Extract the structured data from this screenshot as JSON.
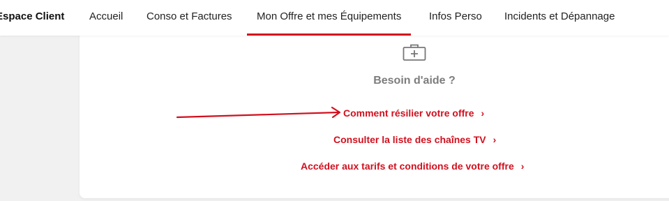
{
  "nav": {
    "brand": "Espace Client",
    "items": [
      {
        "label": "Accueil"
      },
      {
        "label": "Conso et Factures"
      },
      {
        "label": "Mon Offre et mes Équipements"
      },
      {
        "label": "Infos Perso"
      },
      {
        "label": "Incidents et Dépannage"
      }
    ],
    "active_index": 2
  },
  "help": {
    "icon": "medical-kit-icon",
    "title": "Besoin d'aide ?",
    "links": [
      {
        "label": "Comment résilier votre offre",
        "chevron": "›"
      },
      {
        "label": "Consulter la liste des chaînes TV",
        "chevron": "›"
      },
      {
        "label": "Accéder aux tarifs et conditions de votre offre",
        "chevron": "›"
      }
    ]
  },
  "colors": {
    "accent": "#d1101e",
    "muted_title": "#7d7d7d",
    "page_bg": "#f1f1f1"
  }
}
